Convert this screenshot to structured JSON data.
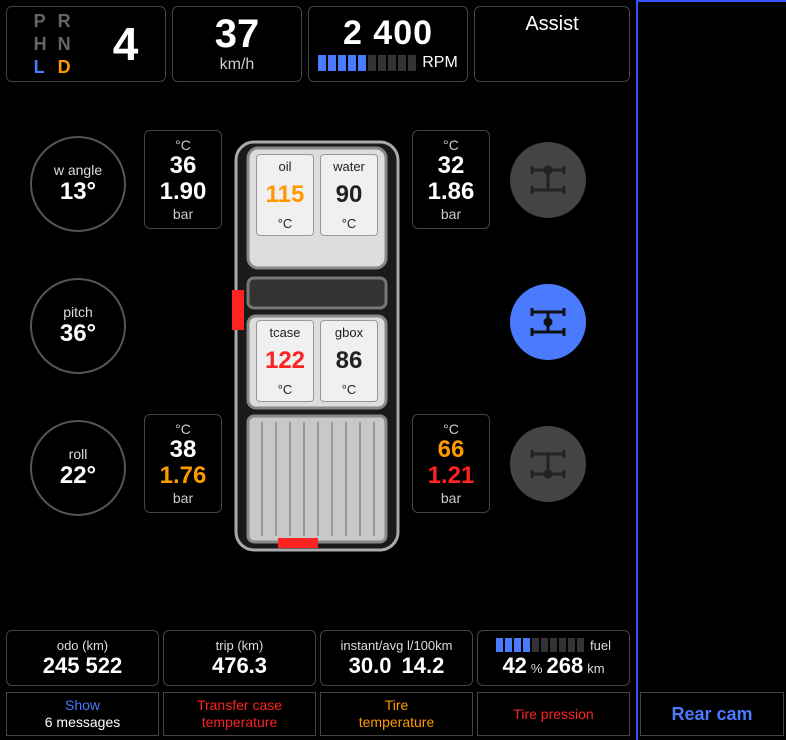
{
  "gear": {
    "p": "P",
    "r": "R",
    "n": "N",
    "d": "D",
    "h": "H",
    "l": "L",
    "current": "4"
  },
  "speed": {
    "value": "37",
    "unit": "km/h"
  },
  "rpm": {
    "value": "2 400",
    "label": "RPM",
    "bars_on": 5,
    "bars_total": 10
  },
  "assist": {
    "label": "Assist"
  },
  "angles": {
    "wangle": {
      "label": "w angle",
      "value": "13°"
    },
    "pitch": {
      "label": "pitch",
      "value": "36°"
    },
    "roll": {
      "label": "roll",
      "value": "22°"
    }
  },
  "tires": {
    "fl": {
      "temp_unit": "°C",
      "temp": "36",
      "press": "1.90",
      "press_unit": "bar",
      "temp_color": "white",
      "press_color": "white"
    },
    "fr": {
      "temp_unit": "°C",
      "temp": "32",
      "press": "1.86",
      "press_unit": "bar",
      "temp_color": "white",
      "press_color": "white"
    },
    "rl": {
      "temp_unit": "°C",
      "temp": "38",
      "press": "1.76",
      "press_unit": "bar",
      "temp_color": "white",
      "press_color": "orange"
    },
    "rr": {
      "temp_unit": "°C",
      "temp": "66",
      "press": "1.21",
      "press_unit": "bar",
      "temp_color": "orange",
      "press_color": "red"
    }
  },
  "engine": {
    "oil": {
      "label": "oil",
      "value": "115",
      "unit": "°C",
      "color": "orange"
    },
    "water": {
      "label": "water",
      "value": "90",
      "unit": "°C",
      "color": "black"
    },
    "tcase": {
      "label": "tcase",
      "value": "122",
      "unit": "°C",
      "color": "red"
    },
    "gbox": {
      "label": "gbox",
      "value": "86",
      "unit": "°C",
      "color": "black"
    }
  },
  "axle": {
    "active_index": 1
  },
  "bottom": {
    "odo": {
      "label": "odo (km)",
      "value": "245 522"
    },
    "trip": {
      "label": "trip (km)",
      "value": "476.3"
    },
    "cons": {
      "label": "instant/avg l/100km",
      "instant": "30.0",
      "avg": "14.2"
    },
    "fuel": {
      "label": "fuel",
      "pct": "42",
      "pct_unit": "%",
      "range": "268",
      "range_unit": "km",
      "bars_on": 4,
      "bars_total": 10
    }
  },
  "alerts": {
    "show": {
      "line1": "Show",
      "line2": "6 messages",
      "color1": "blue",
      "color2": "white"
    },
    "tcase": {
      "line1": "Transfer case",
      "line2": "temperature",
      "color": "red"
    },
    "tire": {
      "line1": "Tire",
      "line2": "temperature",
      "color": "orange"
    },
    "press": {
      "line1": "Tire pression",
      "color": "red"
    }
  },
  "side": {
    "rearcam": "Rear cam"
  }
}
